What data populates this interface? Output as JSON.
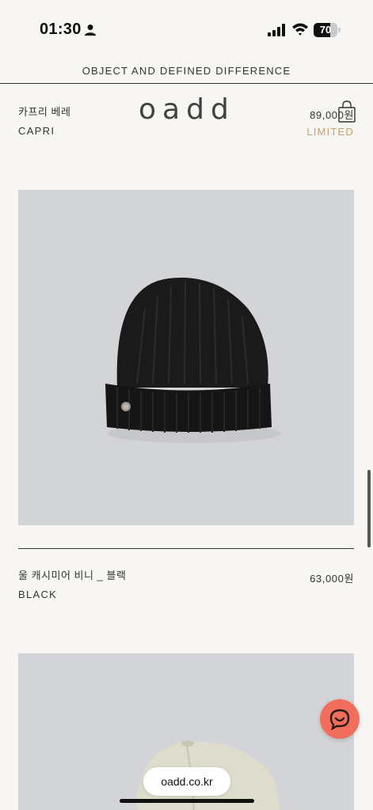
{
  "status_bar": {
    "time": "01:30",
    "battery": "70",
    "battery_level": 0.7
  },
  "header": {
    "tagline": "OBJECT AND DEFINED DIFFERENCE",
    "logo": "oadd"
  },
  "products": [
    {
      "name_ko": "카프리 베레",
      "name_en": "CAPRI",
      "price": "89,000원",
      "badge": "LIMITED"
    },
    {
      "name_ko": "울 캐시미어 비니 _ 블랙",
      "name_en": "BLACK",
      "price": "63,000원"
    }
  ],
  "browser": {
    "url": "oadd.co.kr"
  },
  "colors": {
    "accent_limited": "#c8a16a",
    "chat_button": "#f26e5c",
    "image_bg": "#d3d4d7",
    "page_bg": "#f7f6f3"
  },
  "icons": [
    "person-icon",
    "signal-icon",
    "wifi-icon",
    "battery-icon",
    "bag-icon",
    "chat-icon"
  ]
}
